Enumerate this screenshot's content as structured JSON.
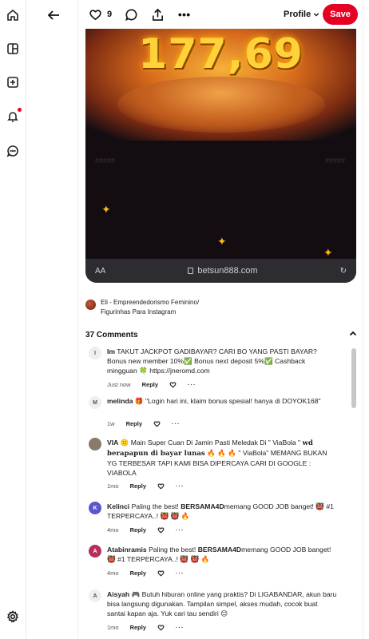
{
  "rail": {
    "icons": [
      "home-icon",
      "explore-icon",
      "create-icon",
      "notifications-icon",
      "messages-icon",
      "settings-icon"
    ]
  },
  "toolbar": {
    "like_count": "9",
    "profile_label": "Profile",
    "save_label": "Save"
  },
  "pin": {
    "image_text": "177,69",
    "ghost_left": "#####",
    "ghost_right": "#####",
    "url_left": "AA",
    "url": "betsun888.com"
  },
  "source": {
    "line1": "Eli - Empreendedorismo Feminino/",
    "line2": "Figurinhas Para Instagram"
  },
  "comments_title": "37 Comments",
  "comments": [
    {
      "initial": "I",
      "avatar_color": "#efefef",
      "name": "Im",
      "text": "TAKUT JACKPOT GADIBAYAR? CARI BO YANG PASTI BAYAR? Bonus new member 10%✅ Bonus next deposit 5%✅ Cashback mingguan 🍀 https://jneromd.com",
      "time": "Just now",
      "reply": "Reply"
    },
    {
      "initial": "M",
      "avatar_color": "#efefef",
      "name": "melinda",
      "text": "🎁 \"Login hari ini, klaim bonus spesial! hanya di DOYOK168\"",
      "time": "1w",
      "reply": "Reply"
    },
    {
      "initial": "",
      "avatar_color": "#8a7a6a",
      "name": "VIA",
      "text_a": "🙂 Main Super Cuan Di Jamin Pasti Meledak Di \" ViaBola \" ",
      "text_b": "wd berapapun di bayar lunas",
      "text_c": " 🔥 🔥 🔥 \" ViaBola\" MEMANG BUKAN YG TERBESAR TAPI KAMI BISA DIPERCAYA CARI DI GOOGLE : VIABOLA",
      "time": "1mo",
      "reply": "Reply"
    },
    {
      "initial": "K",
      "avatar_color": "#5b57c9",
      "name": "Kelinci",
      "text_a": "Paling the best! ",
      "text_b": "BERSAMA4D",
      "text_c": "memang GOOD JOB banget! 👹 #1 TERPERCAYA..! 👹 👹 🔥",
      "time": "4mo",
      "reply": "Reply"
    },
    {
      "initial": "A",
      "avatar_color": "#b3315a",
      "name": "Atabinramis",
      "text_a": "Paling the best! ",
      "text_b": "BERSAMA4D",
      "text_c": "memang GOOD JOB banget! 👹 #1 TERPERCAYA..! 👹 👹 🔥",
      "time": "4mo",
      "reply": "Reply"
    },
    {
      "initial": "A",
      "avatar_color": "#efefef",
      "name": "Aisyah",
      "text": "🎮 Butuh hiburan online yang praktis? Di LIGABANDAR, akun baru bisa langsung digunakan. Tampilan simpel, akses mudah, cocok buat santai kapan aja. Yuk cari tau sendiri 😊",
      "time": "1mo",
      "reply": "Reply"
    }
  ]
}
